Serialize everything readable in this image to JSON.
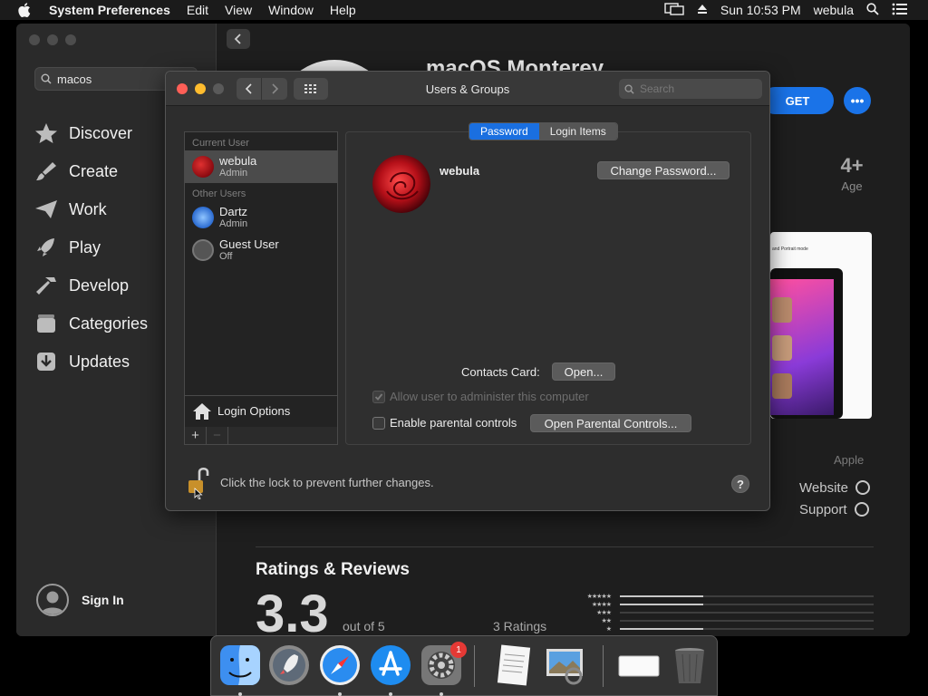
{
  "menubar": {
    "app": "System Preferences",
    "items": [
      "Edit",
      "View",
      "Window",
      "Help"
    ],
    "clock": "Sun 10:53 PM",
    "user": "webula"
  },
  "appstore": {
    "search_value": "macos",
    "nav": [
      {
        "label": "Discover",
        "icon": "star-icon"
      },
      {
        "label": "Create",
        "icon": "brush-icon"
      },
      {
        "label": "Work",
        "icon": "paperplane-icon"
      },
      {
        "label": "Play",
        "icon": "rocket-icon"
      },
      {
        "label": "Develop",
        "icon": "hammer-icon"
      },
      {
        "label": "Categories",
        "icon": "stack-icon"
      },
      {
        "label": "Updates",
        "icon": "download-icon"
      }
    ],
    "sign_in": "Sign In",
    "app_title": "macOS Monterey",
    "get_label": "GET",
    "more_label": "•••",
    "age_value": "4+",
    "age_label": "Age",
    "shot_caption": "and Portrait mode",
    "developer": "Apple",
    "website": "Website",
    "support": "Support",
    "ratings_title": "Ratings & Reviews",
    "rating": "3.3",
    "out_of": "out of 5",
    "ratings_count": "3 Ratings",
    "star_rows": [
      {
        "stars": "★★★★★",
        "fraction": 0.33
      },
      {
        "stars": "★★★★",
        "fraction": 0.33
      },
      {
        "stars": "★★★",
        "fraction": 0
      },
      {
        "stars": "★★",
        "fraction": 0
      },
      {
        "stars": "★",
        "fraction": 0.33
      }
    ]
  },
  "users_groups": {
    "title": "Users & Groups",
    "search_placeholder": "Search",
    "current_user_header": "Current User",
    "other_users_header": "Other Users",
    "users": [
      {
        "name": "webula",
        "role": "Admin",
        "selected": true
      },
      {
        "name": "Dartz",
        "role": "Admin",
        "selected": false
      },
      {
        "name": "Guest User",
        "role": "Off",
        "selected": false
      }
    ],
    "login_options": "Login Options",
    "add_label": "+",
    "remove_label": "−",
    "tabs": [
      "Password",
      "Login Items"
    ],
    "active_tab": "Password",
    "selected_user": "webula",
    "change_password": "Change Password...",
    "contacts_card_label": "Contacts Card:",
    "open_label": "Open...",
    "allow_admin": "Allow user to administer this computer",
    "parental_controls": "Enable parental controls",
    "open_parental": "Open Parental Controls...",
    "lock_text": "Click the lock to prevent further changes.",
    "help_label": "?"
  },
  "dock": {
    "items": [
      "finder-icon",
      "launchpad-icon",
      "safari-icon",
      "app-store-icon",
      "system-preferences-icon",
      "textedit-icon",
      "preview-icon",
      "window-icon",
      "trash-icon"
    ],
    "badge": "1"
  },
  "colors": {
    "accent": "#1a73e8",
    "tab_active": "#1a6fe0",
    "close": "#ff5f57",
    "minimize": "#febc2e"
  }
}
